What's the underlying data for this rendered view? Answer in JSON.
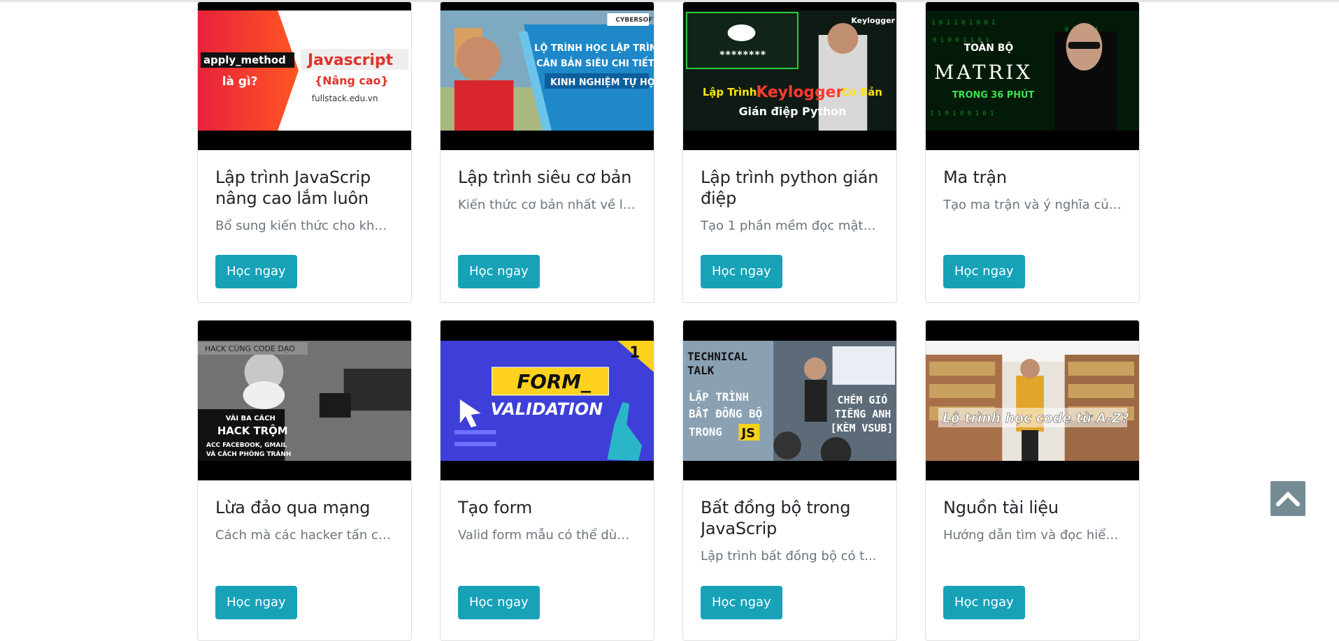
{
  "courses": [
    {
      "title": "Lập trình JavaScrip nâng cao lắm luôn",
      "desc": "Bổ sung kiến thức cho khó...",
      "button": "Học ngay",
      "thumb": {
        "t1": "apply_method",
        "t2": "là gì?",
        "t3": "Javascript",
        "t4": "{Nâng cao}",
        "t5": "fullstack.edu.vn"
      }
    },
    {
      "title": "Lập trình siêu cơ bản",
      "desc": "Kiến thức cơ bản nhất về lậ...",
      "button": "Học ngay",
      "thumb": {
        "t1": "CYBERSOFT",
        "t2": "LỘ TRÌNH HỌC LẬP TRÌNH",
        "t3": "CĂN BẢN SIÊU CHI TIẾT",
        "t4": "KINH NGHIỆM TỰ HỌC"
      }
    },
    {
      "title": "Lập trình python gián điệp",
      "desc": "Tạo 1 phần mềm đọc mật ...",
      "button": "Học ngay",
      "thumb": {
        "t1": "Keylogger",
        "t2": "********",
        "t3": "Lập Trình",
        "t4": "Keylogger",
        "t5": "Cơ Bản",
        "t6": "Gián điệp Python"
      }
    },
    {
      "title": "Ma trận",
      "desc": "Tạo ma trận và ý nghĩa của...",
      "button": "Học ngay",
      "thumb": {
        "t1": "TOÀN BỘ",
        "t2": "MATRIX",
        "t3": "TRONG 36 PHÚT"
      }
    },
    {
      "title": "Lừa đảo qua mạng",
      "desc": "Cách mà các hacker tấn cô...",
      "button": "Học ngay",
      "thumb": {
        "t1": "HACK CÙNG CODE DẠO",
        "t2": "VÀI BA CÁCH",
        "t3": "HACK TRỘM",
        "t4": "ACC FACEBOOK, GMAIL",
        "t5": "VÀ CÁCH PHÒNG TRÁNH"
      }
    },
    {
      "title": "Tạo form",
      "desc": "Valid form mẫu có thể dùn...",
      "button": "Học ngay",
      "thumb": {
        "t1": "1",
        "t2": "FORM_",
        "t3": "VALIDATION"
      }
    },
    {
      "title": "Bất đồng bộ trong JavaScrip",
      "desc": "Lập trình bất đồng bộ có t...",
      "button": "Học ngay",
      "thumb": {
        "t1": "TECHNICAL",
        "t2": "TALK",
        "t3": "LẬP TRÌNH",
        "t4": "BẤT ĐỒNG BỘ",
        "t5": "TRONG",
        "t6": "JS",
        "t7": "CHÉM GIÓ",
        "t8": "TIẾNG ANH",
        "t9": "[KÈM VSUB]"
      }
    },
    {
      "title": "Nguồn tài liệu",
      "desc": "Hướng dẫn tìm và đọc hiểu...",
      "button": "Học ngay",
      "thumb": {
        "t1": "Lộ trình học code từ A-Z?"
      }
    }
  ],
  "scroll_top": {
    "icon": "chevron-up-icon"
  },
  "colors": {
    "button": "#17a2b8",
    "scroll_top": "#758b94"
  }
}
